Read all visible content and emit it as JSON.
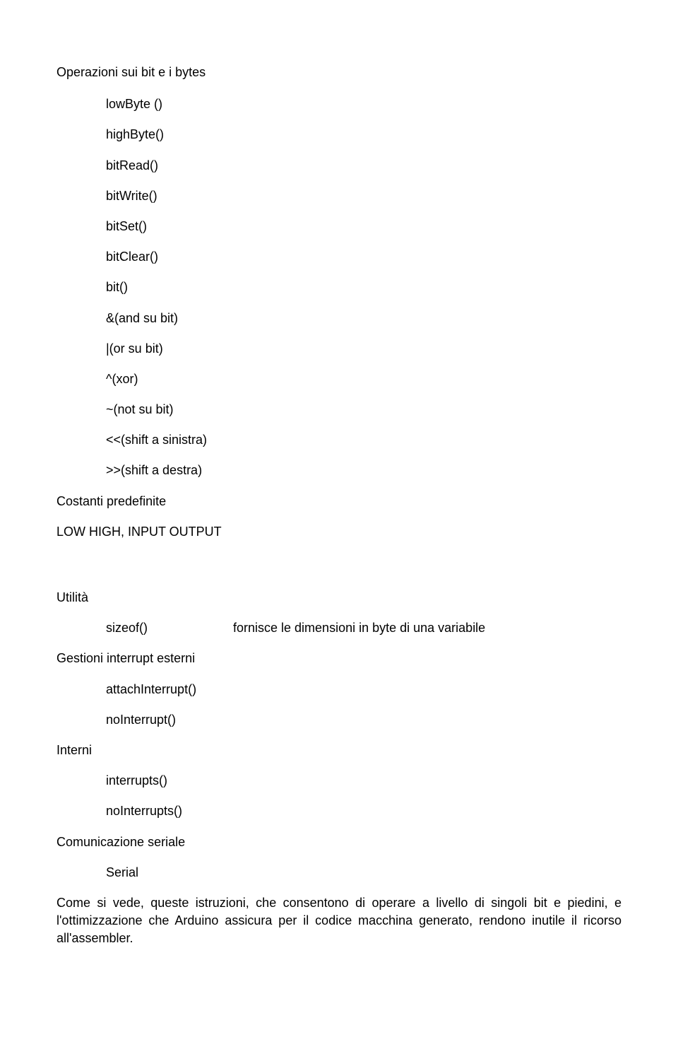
{
  "s1": {
    "title": "Operazioni sui bit e i bytes",
    "items": [
      "lowByte ()",
      "highByte()",
      "bitRead()",
      "bitWrite()",
      "bitSet()",
      "bitClear()",
      "bit()",
      "&(and su bit)",
      "|(or su bit)",
      "^(xor)",
      "~(not su bit)",
      "<<(shift a sinistra)",
      ">>(shift a destra)"
    ]
  },
  "s2": {
    "title": "Costanti predefinite",
    "line": "LOW HIGH, INPUT OUTPUT"
  },
  "s3": {
    "title": "Utilità",
    "item": "sizeof()",
    "desc": "fornisce le dimensioni in byte di una variabile"
  },
  "s4": {
    "title": "Gestioni interrupt esterni",
    "items": [
      "attachInterrupt()",
      "noInterrupt()"
    ]
  },
  "s5": {
    "title": "Interni",
    "items": [
      "interrupts()",
      "noInterrupts()"
    ]
  },
  "s6": {
    "title": "Comunicazione seriale",
    "items": [
      "Serial"
    ]
  },
  "closing": "Come si vede, queste istruzioni, che consentono di operare a livello di singoli bit e piedini, e l'ottimizzazione che Arduino assicura per il codice macchina generato, rendono inutile il ricorso all'assembler."
}
